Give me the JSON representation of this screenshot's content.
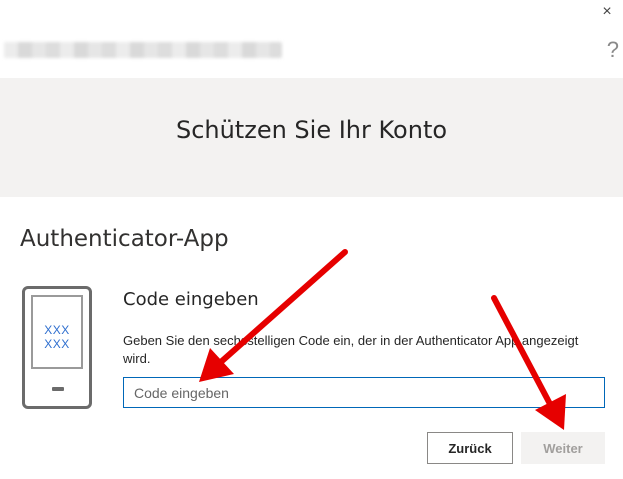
{
  "window": {
    "close_glyph": "×",
    "help_glyph": "?"
  },
  "header": {
    "title": "Schützen Sie Ihr Konto"
  },
  "section": {
    "title": "Authenticator-App"
  },
  "phone": {
    "code_display": "XXX XXX"
  },
  "form": {
    "heading": "Code eingeben",
    "description": "Geben Sie den sechsstelligen Code ein, der in der Authenticator App angezeigt wird.",
    "input_value": "",
    "input_placeholder": "Code eingeben"
  },
  "buttons": {
    "back": "Zurück",
    "next": "Weiter"
  },
  "colors": {
    "accent": "#0067b8",
    "arrow": "#e60000",
    "hero_background": "#f3f2f1"
  },
  "icons": {
    "close": "close-icon",
    "help": "help-icon",
    "phone": "phone-icon"
  }
}
